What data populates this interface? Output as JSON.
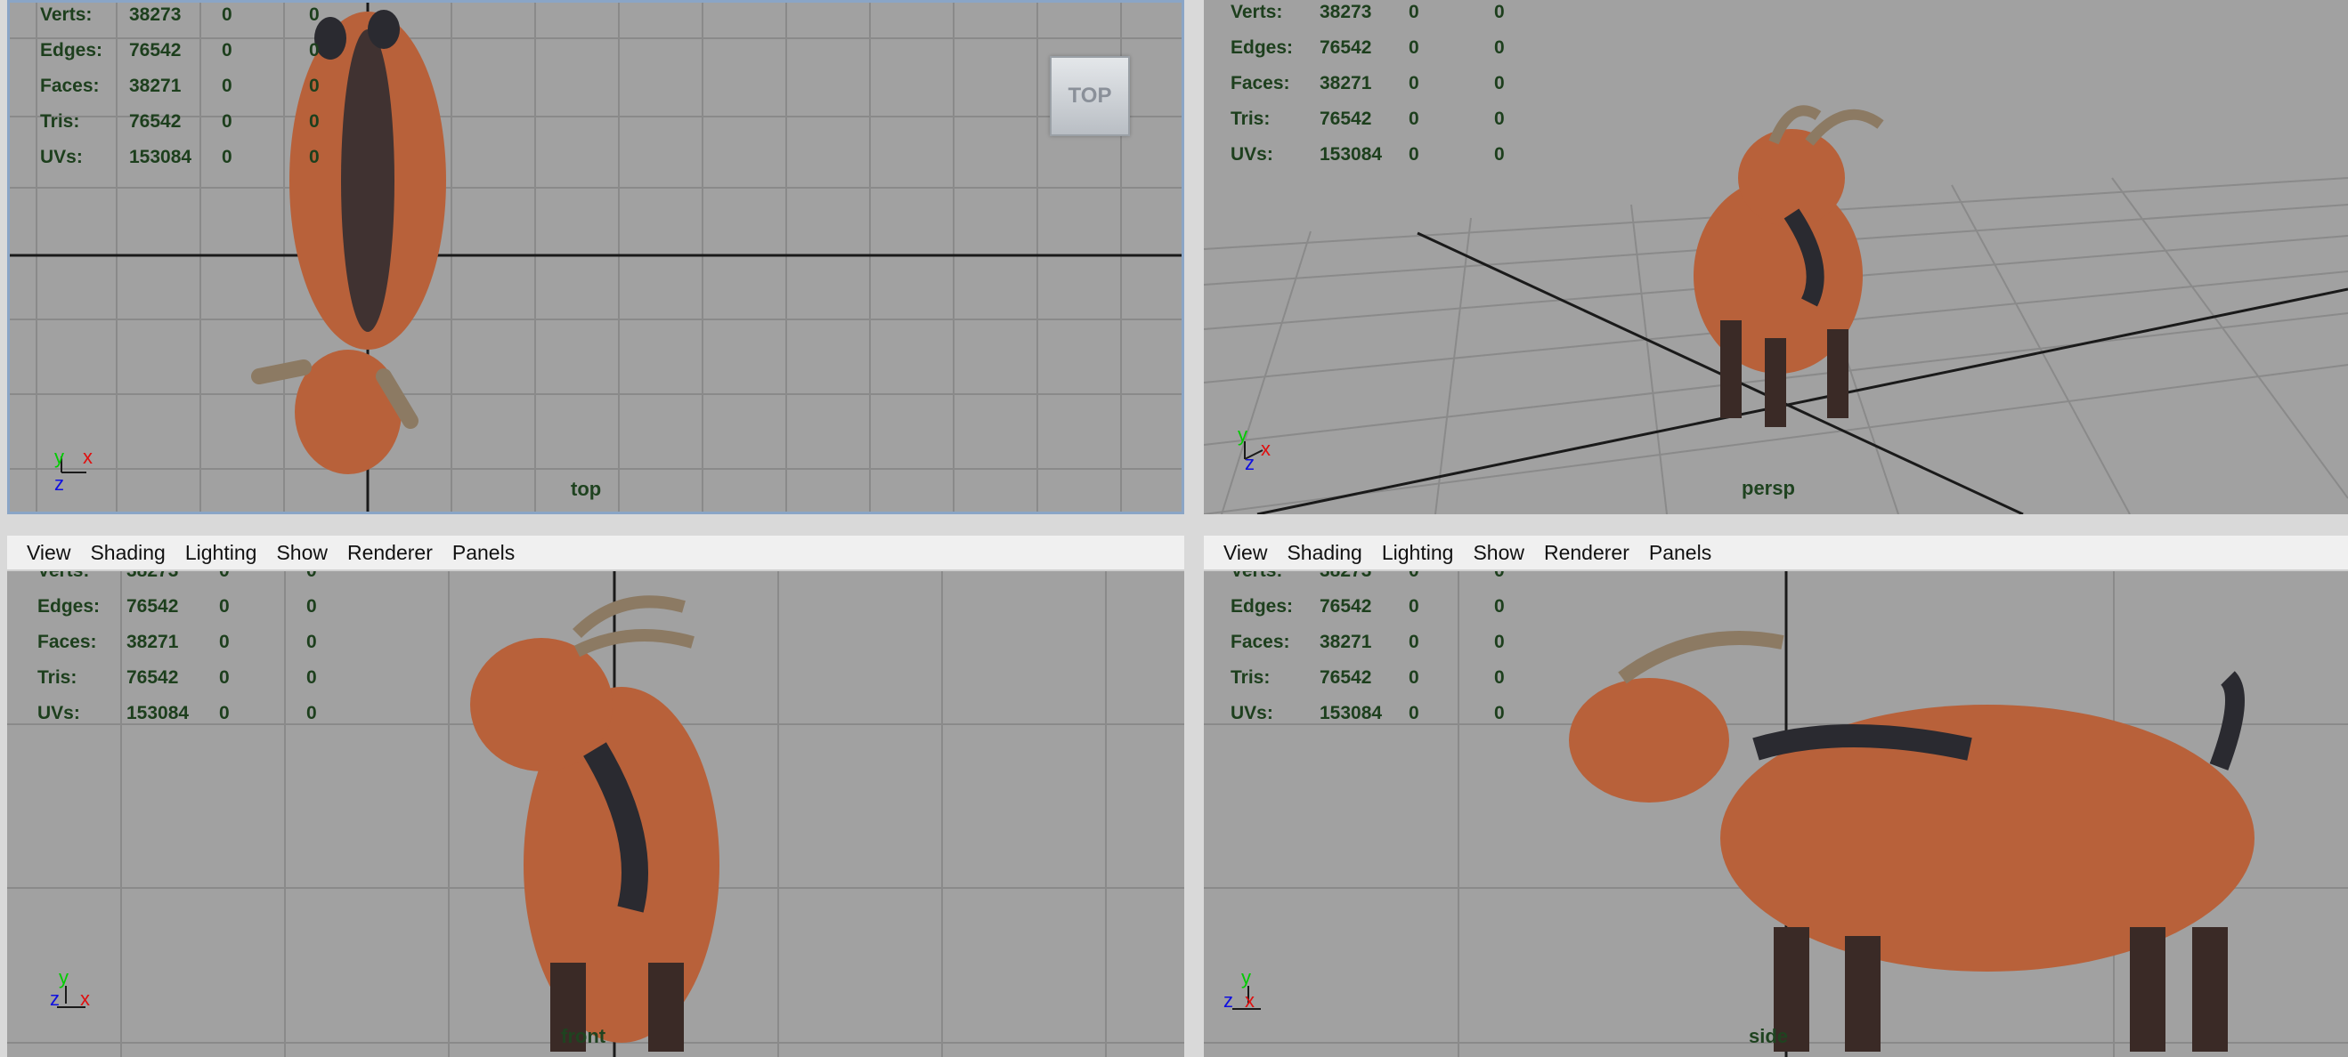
{
  "colors": {
    "viewport_bg": "#a1a1a1",
    "grid_line": "#8a8a8a",
    "axis_line": "#1a1a1a",
    "hud_text": "#1d3f1d",
    "panel_border": "#dcdcdc",
    "active_border": "#8aa5c6",
    "menubar_bg": "#f0f0f0",
    "goat_fur": "#b8613a",
    "goat_dark": "#2a2a30"
  },
  "hud_labels": [
    "Verts:",
    "Edges:",
    "Faces:",
    "Tris:",
    "UVs:"
  ],
  "hud_values": [
    [
      "38273",
      "0",
      "0"
    ],
    [
      "76542",
      "0",
      "0"
    ],
    [
      "38271",
      "0",
      "0"
    ],
    [
      "76542",
      "0",
      "0"
    ],
    [
      "153084",
      "0",
      "0"
    ]
  ],
  "menu": [
    "View",
    "Shading",
    "Lighting",
    "Show",
    "Renderer",
    "Panels"
  ],
  "viewports": {
    "top": {
      "label": "top",
      "viewcube": "TOP",
      "gizmo": {
        "up": "y",
        "right": "x",
        "depth": "z"
      }
    },
    "persp": {
      "label": "persp",
      "gizmo": {
        "up": "y",
        "right": "x",
        "depth": "z"
      }
    },
    "front": {
      "label": "front",
      "gizmo": {
        "up": "y",
        "right": "x",
        "depth": "z"
      }
    },
    "side": {
      "label": "side",
      "gizmo": {
        "up": "y",
        "right": "x",
        "depth": "z"
      }
    }
  },
  "icons": [
    "axis-gizmo-icon",
    "viewcube-icon"
  ]
}
